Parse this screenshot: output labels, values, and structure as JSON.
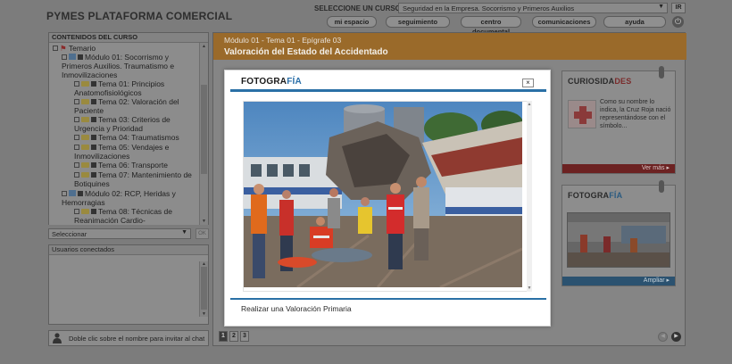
{
  "header": {
    "brand": "PYMES PLATAFORMA COMERCIAL",
    "course_label": "SELECCIONE UN CURSO:",
    "course_value": "Seguridad en la Empresa. Socorrismo y Primeros Auxilios",
    "ir_label": "IR",
    "nav": [
      "mi espacio",
      "seguimiento",
      "centro documental",
      "comunicaciones",
      "ayuda"
    ]
  },
  "contents": {
    "title": "CONTENIDOS DEL CURSO",
    "tree": [
      "Temario",
      "Módulo 01: Socorrismo y Primeros Auxilios. Traumatismo e Inmovilizaciones",
      "Tema 01: Principios Anatomofisiológicos",
      "Tema 02: Valoración del Paciente",
      "Tema 03: Criterios de Urgencia y Prioridad",
      "Tema 04: Traumatismos",
      "Tema 05: Vendajes e Inmovilizaciones",
      "Tema 06: Transporte",
      "Tema 07: Mantenimiento de Botiquines",
      "Módulo 02: RCP, Heridas y Hemorragias",
      "Tema 08: Técnicas de Reanimación Cardio-"
    ],
    "select_label": "Seleccionar",
    "ok_label": "OK"
  },
  "users": {
    "title": "Usuarios conectados",
    "hint": "Doble clic sobre el nombre para invitar al chat"
  },
  "main": {
    "breadcrumb": "Módulo 01 - Tema 01 - Epígrafe 03",
    "title": "Valoración del Estado del Accidentado",
    "pages": [
      "1",
      "2",
      "3"
    ]
  },
  "curiosidades": {
    "title_a": "CURIOSIDA",
    "title_b": "DES",
    "text": "Como su nombre lo indica, la Cruz Roja nació representándose con el símbolo...",
    "more": "Ver más"
  },
  "fotografia_card": {
    "title_a": "FOTOGRA",
    "title_b": "FÍA",
    "zoom": "Ampliar"
  },
  "modal": {
    "title_a": "FOTOGRA",
    "title_b": "FÍA",
    "close": "×",
    "caption": "Realizar una Valoración Primaria"
  },
  "colors": {
    "accent_orange": "#9a6a2a",
    "accent_blue": "#2a70a6",
    "accent_red": "#6c2222"
  }
}
